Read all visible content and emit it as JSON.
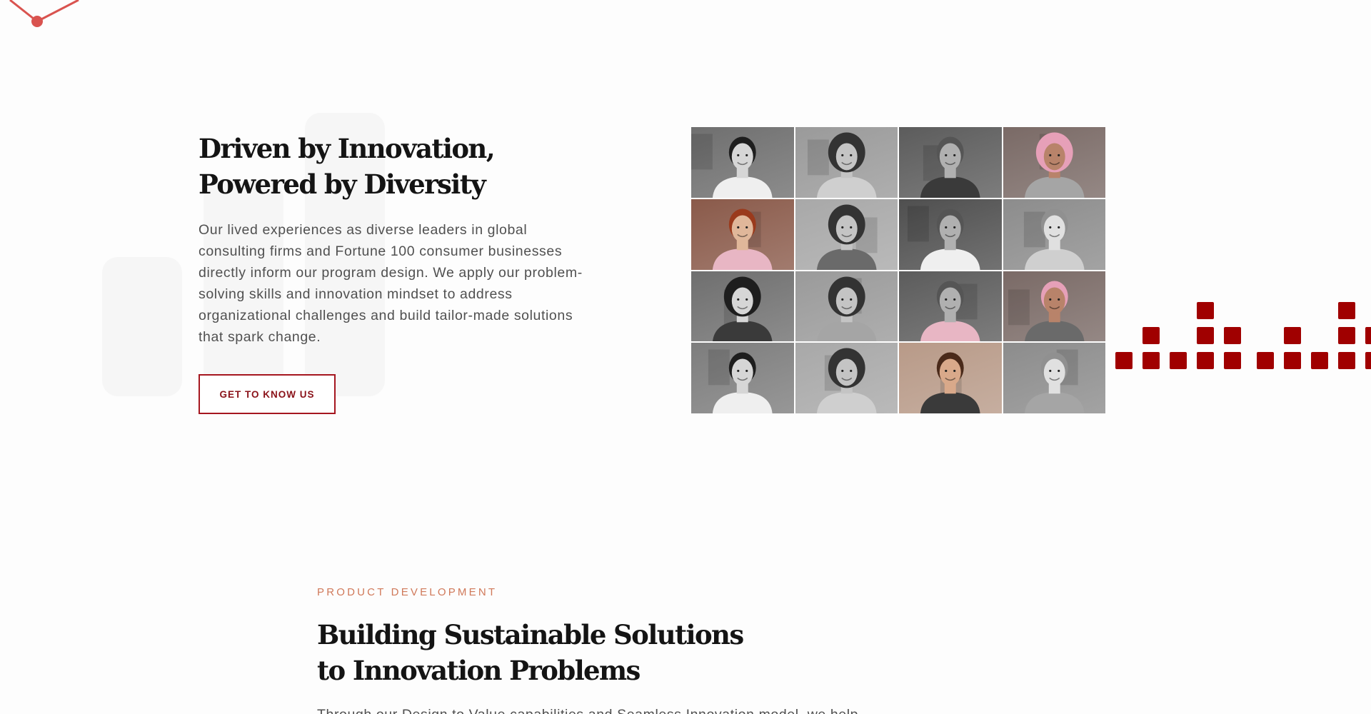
{
  "hero": {
    "title_line1": "Driven by Innovation,",
    "title_line2": "Powered by Diversity",
    "body": "Our lived experiences as diverse leaders in global consulting firms and Fortune 100 consumer businesses directly inform our program design. We apply our problem-solving skills and innovation mindset to address organizational challenges and build tailor-made solutions that spark change.",
    "cta_label": "GET TO KNOW US"
  },
  "photo_grid": {
    "portraits": [
      {
        "icon": "portrait-photo",
        "tone": "grayscale"
      },
      {
        "icon": "portrait-photo",
        "tone": "grayscale"
      },
      {
        "icon": "portrait-photo",
        "tone": "grayscale"
      },
      {
        "icon": "portrait-photo",
        "tone": "color"
      },
      {
        "icon": "portrait-photo",
        "tone": "color"
      },
      {
        "icon": "portrait-photo",
        "tone": "grayscale"
      },
      {
        "icon": "portrait-photo",
        "tone": "grayscale"
      },
      {
        "icon": "portrait-photo",
        "tone": "grayscale"
      },
      {
        "icon": "portrait-photo",
        "tone": "grayscale"
      },
      {
        "icon": "portrait-photo",
        "tone": "grayscale"
      },
      {
        "icon": "portrait-photo",
        "tone": "grayscale"
      },
      {
        "icon": "portrait-photo",
        "tone": "color"
      },
      {
        "icon": "portrait-photo",
        "tone": "grayscale"
      },
      {
        "icon": "portrait-photo",
        "tone": "grayscale"
      },
      {
        "icon": "portrait-photo",
        "tone": "color"
      },
      {
        "icon": "portrait-photo",
        "tone": "grayscale"
      }
    ]
  },
  "product_section": {
    "eyebrow": "PRODUCT DEVELOPMENT",
    "title_line1": "Building Sustainable Solutions",
    "title_line2": "to Innovation Problems",
    "body_partial": "Through our Design to Value capabilities and Seamless Innovation model, we help"
  },
  "colors": {
    "accent": "#a00000",
    "button_border": "#a5161f",
    "eyebrow": "#d0795a",
    "connector": "#d9534f"
  },
  "decor": {
    "connector_icon": "network-node-icon",
    "equalizer_icon": "equalizer-blocks-icon"
  }
}
